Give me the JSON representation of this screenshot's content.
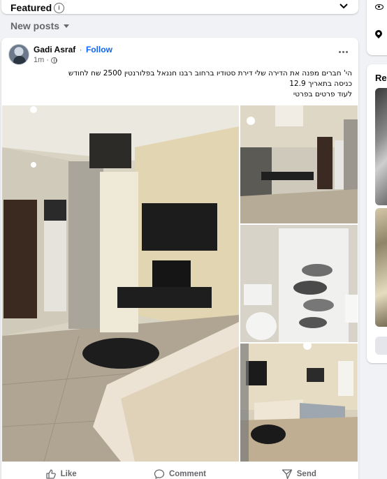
{
  "featured": {
    "title": "Featured"
  },
  "feed": {
    "sort_label": "New posts"
  },
  "post": {
    "author": "Gadi Asraf",
    "separator": "·",
    "follow_label": "Follow",
    "time": "1m ·",
    "text_lines": [
      "הי' חברים מפנה את הדירה שלי דירת סטודיו ברחוב רבנו חננאל בפלורנטין 2500 שח לחודש",
      "כניסה בתאריך 12.9",
      "לעוד פרטים בפרטי"
    ],
    "actions": {
      "like": "Like",
      "comment": "Comment",
      "send": "Send"
    }
  },
  "right_column": {
    "rec_title": "Rec"
  },
  "icons": [
    "info-icon",
    "chevron-down-icon",
    "caret-down-icon",
    "globe-icon",
    "more-icon",
    "like-icon",
    "comment-icon",
    "send-icon",
    "eye-icon",
    "location-pin-icon"
  ],
  "colors": {
    "link": "#0866ff",
    "secondary_text": "#65676b",
    "background": "#f0f2f5"
  }
}
